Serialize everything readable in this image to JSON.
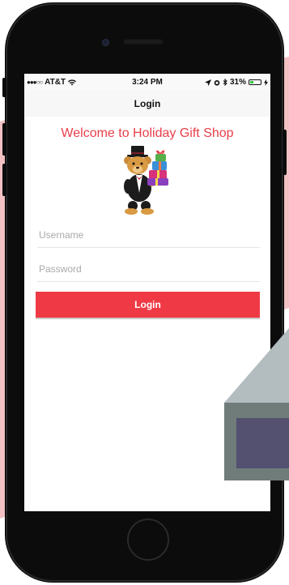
{
  "status_bar": {
    "carrier": "AT&T",
    "signal": "●●●○○",
    "time": "3:24 PM",
    "battery_percent": "31%",
    "battery_level": 0.31
  },
  "nav": {
    "title": "Login"
  },
  "shop": {
    "welcome": "Welcome to Holiday Gift Shop"
  },
  "form": {
    "username_placeholder": "Username",
    "username_value": "",
    "password_placeholder": "Password",
    "password_value": "",
    "login_label": "Login"
  },
  "colors": {
    "accent": "#ef3a46",
    "welcome_text": "#e83e4a",
    "background_pink": "#f3c1c3",
    "house_roof": "#b3bdc0",
    "house_wall": "#6f7c7a",
    "house_window": "#535070"
  },
  "icons": {
    "wifi": "wifi-icon",
    "location": "location-arrow-icon",
    "alarm": "alarm-icon",
    "bluetooth": "bluetooth-icon",
    "battery": "battery-icon",
    "charging": "charging-bolt-icon"
  }
}
